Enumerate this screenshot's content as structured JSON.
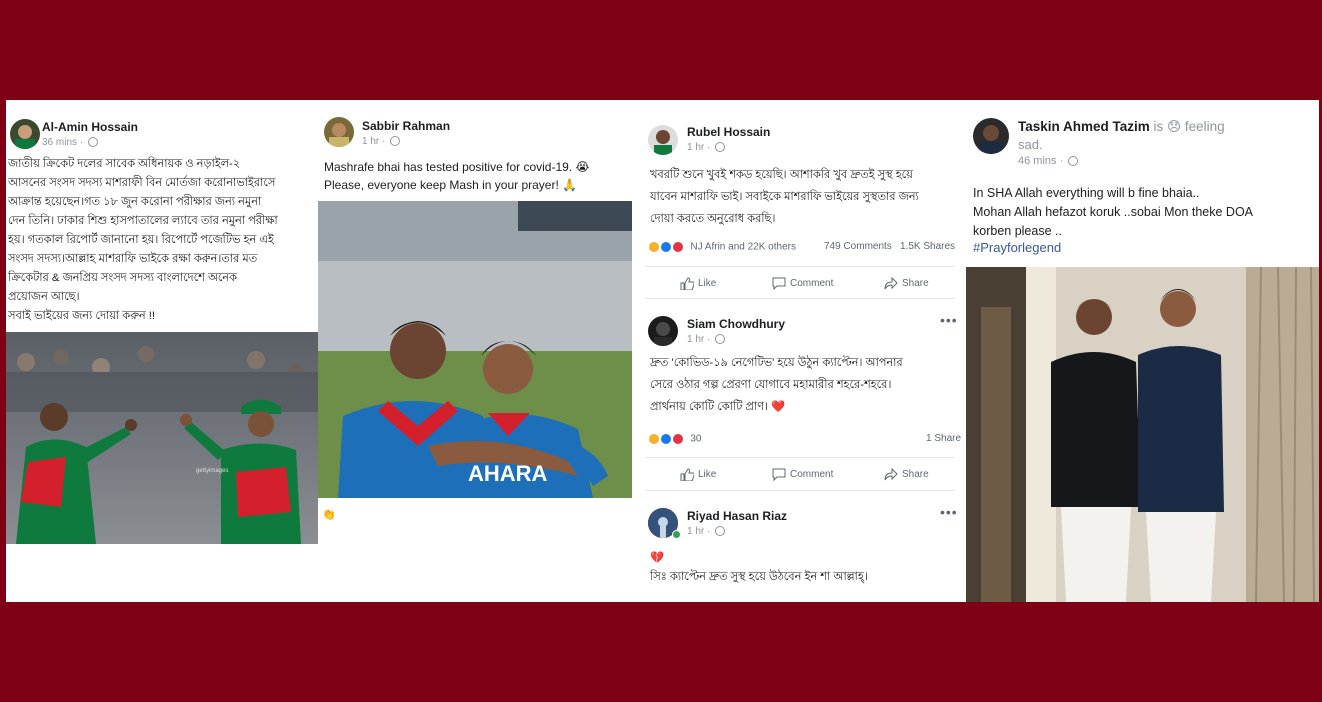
{
  "posts": [
    {
      "author": "Al-Amin Hossain",
      "time": "36 mins",
      "text": [
        "জাতীয় ক্রিকেট দলের সাবেক অধিনায়ক ও নড়াইল-২",
        "আসনের সংসদ সদস্য মাশরাফী বিন মোর্তজা করোনাভাইরাসে",
        "আক্রান্ত হয়েছেন।গত ১৮ জুন করোনা পরীক্ষার জন্য নমুনা",
        "দেন তিনি। ঢাকার শিশু হাসপাতালের ল্যাবে তার নমুনা পরীক্ষা",
        "হয়। গতকাল রিপোর্ট জানানো হয়। রিপোর্টে পজেটিভ হন এই",
        "সংসদ সদস্য।আল্লাহ মাশরাফি ভাইকে রক্ষা করুন।তার মত",
        "ক্রিকেটার & জনপ্রিয় সংসদ সদস্য বাংলাদেশে অনেক",
        "প্রয়োজন আছে।",
        "সবাই ভাইয়ের জন্য দোয়া করুন !!"
      ]
    },
    {
      "author": "Sabbir Rahman",
      "time": "1 hr",
      "text": [
        "Mashrafe bhai has tested positive for covid-19. 😭",
        "Please, everyone keep Mash in your prayer! 🙏"
      ],
      "jersey_text": "AHARA"
    },
    {
      "author": "Rubel Hossain",
      "time": "1 hr",
      "text": [
        "খবরটি শুনে খুবই শকড হয়েছি। আশাকরি খুব দ্রুতই সুস্থ হয়ে",
        "যাবেন মাশরাফি ভাই। সবাইকে মাশরাফি ভাইয়ের সুস্থতার জন্য",
        "দোয়া করতে অনুরোধ করছি।"
      ],
      "reactions": "NJ Afrin and 22K others",
      "comments": "749 Comments",
      "shares": "1.5K Shares",
      "like_label": "Like",
      "comment_label": "Comment",
      "share_label": "Share"
    },
    {
      "author": "Siam Chowdhury",
      "time": "1 hr",
      "text": [
        "দ্রুত 'কোভিড-১৯ নেগেটিভ' হয়ে উঠুন ক্যাপ্টেন। আপনার",
        "সেরে ওঠার গল্প প্রেরণা যোগাবে মহামারীর শহরে-শহরে।",
        "প্রার্থনায় কোটি কোটি প্রাণ। ❤️"
      ],
      "reactions": "30",
      "shares": "1 Share",
      "like_label": "Like",
      "comment_label": "Comment",
      "share_label": "Share"
    },
    {
      "author": "Riyad Hasan Riaz",
      "time": "1 hr",
      "text": [
        "💔",
        "সিঃ ক্যাপ্টেন দ্রুত সুস্থ হয়ে উঠবেন ইন শা আল্লাহ্‌।"
      ]
    },
    {
      "author": "Taskin Ahmed Tazim",
      "status": "is 😞 feeling",
      "status2": "sad.",
      "time": "46 mins",
      "text": [
        "In SHA Allah everything will b fine bhaia..",
        "Mohan Allah hefazot koruk ..sobai Mon theke DOA",
        "korben please .."
      ],
      "hashtag": "#Prayforlegend"
    }
  ],
  "colors": {
    "background": "#7d0015",
    "card": "#ffffff",
    "link": "#385898",
    "bd_green": "#00843d",
    "bd_red": "#d4202c"
  }
}
